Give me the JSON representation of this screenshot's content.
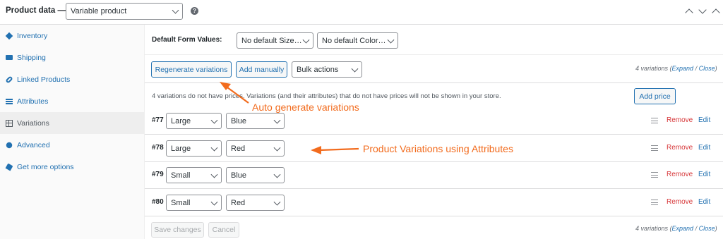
{
  "header": {
    "title": "Product data —",
    "product_type": "Variable product",
    "help_glyph": "?"
  },
  "sidebar": {
    "items": [
      {
        "label": "Inventory",
        "icon": "tag-icon",
        "active": false
      },
      {
        "label": "Shipping",
        "icon": "truck-icon",
        "active": false
      },
      {
        "label": "Linked Products",
        "icon": "link-icon",
        "active": false
      },
      {
        "label": "Attributes",
        "icon": "list-icon",
        "active": false
      },
      {
        "label": "Variations",
        "icon": "grid-icon",
        "active": true
      },
      {
        "label": "Advanced",
        "icon": "gear-icon",
        "active": false
      },
      {
        "label": "Get more options",
        "icon": "plug-icon",
        "active": false
      }
    ]
  },
  "defaults": {
    "label": "Default Form Values:",
    "size_select": "No default Size…",
    "color_select": "No default Color…"
  },
  "toolbar": {
    "regenerate": "Regenerate variations",
    "add_manually": "Add manually",
    "bulk_actions": "Bulk actions",
    "count_text": "4 variations (",
    "expand": "Expand",
    "sep": " / ",
    "close": "Close",
    "count_end": ")"
  },
  "notice": {
    "text": "4 variations do not have prices. Variations (and their attributes) that do not have prices will not be shown in your store.",
    "add_price": "Add price"
  },
  "variations": [
    {
      "num": "#77",
      "size": "Large",
      "color": "Blue"
    },
    {
      "num": "#78",
      "size": "Large",
      "color": "Red"
    },
    {
      "num": "#79",
      "size": "Small",
      "color": "Blue"
    },
    {
      "num": "#80",
      "size": "Small",
      "color": "Red"
    }
  ],
  "row_actions": {
    "remove": "Remove",
    "edit": "Edit"
  },
  "footer": {
    "save": "Save changes",
    "cancel": "Cancel"
  },
  "annotations": {
    "auto": "Auto generate variations",
    "attrs": "Product Variations using Attributes",
    "color": "#f26b1d"
  },
  "colors": {
    "link": "#2271b1",
    "remove": "#d63638",
    "annotation": "#f26b1d"
  }
}
